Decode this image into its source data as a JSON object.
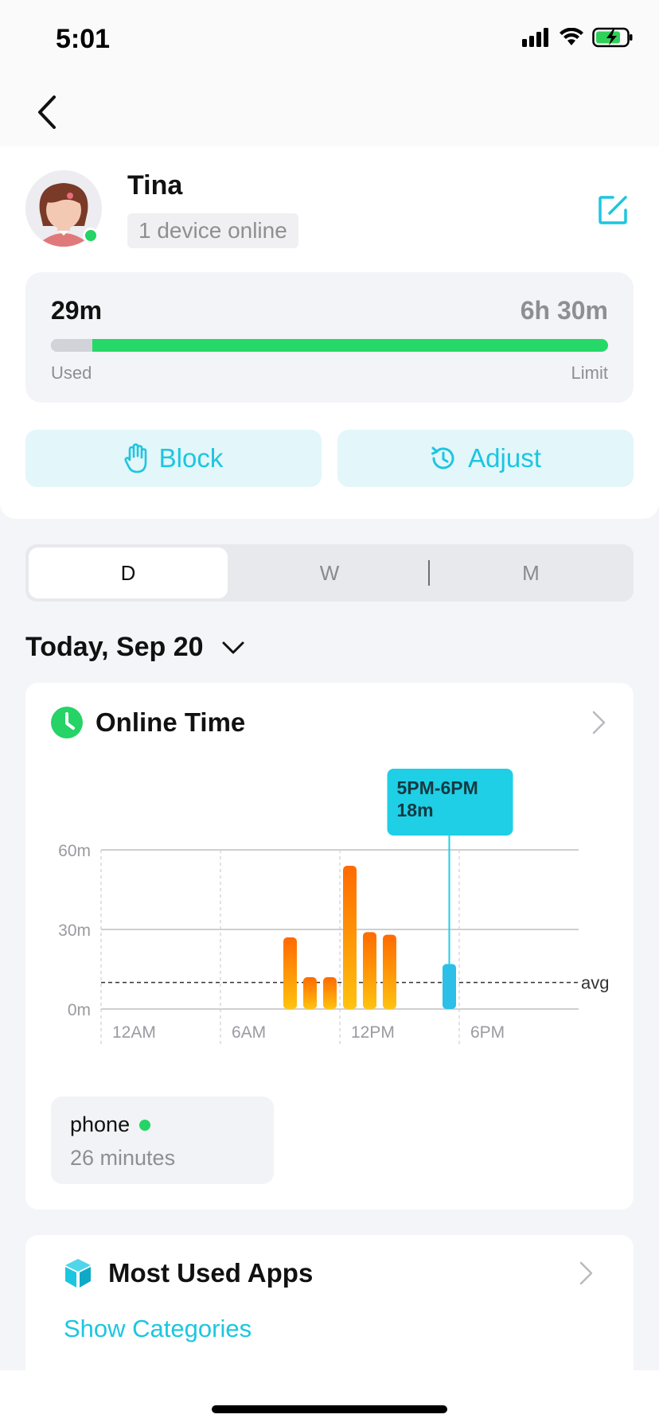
{
  "status_bar": {
    "time": "5:01"
  },
  "profile": {
    "name": "Tina",
    "device_status": "1 device online",
    "avatar_icon": "girl-avatar-icon",
    "edit_icon": "edit-icon"
  },
  "usage": {
    "used_value": "29m",
    "limit_value": "6h 30m",
    "used_label": "Used",
    "limit_label": "Limit",
    "used_fraction": 0.074,
    "track_color": "#26d868"
  },
  "actions": {
    "block_label": "Block",
    "adjust_label": "Adjust",
    "accent_color": "#1cc6e0"
  },
  "period_tabs": {
    "items": [
      "D",
      "W",
      "M"
    ],
    "selected": "D"
  },
  "date_selector": {
    "label": "Today, Sep 20"
  },
  "online_time": {
    "title": "Online Time",
    "device": {
      "name": "phone",
      "minutes": "26 minutes"
    }
  },
  "most_used_apps": {
    "title": "Most Used Apps",
    "link": "Show Categories"
  },
  "chart_data": {
    "type": "bar",
    "title": "Online Time",
    "x_tick_labels": [
      "12AM",
      "6AM",
      "12PM",
      "6PM"
    ],
    "y_tick_labels": [
      "60m",
      "30m",
      "0m"
    ],
    "ylim": [
      0,
      60
    ],
    "categories": [
      "9AM",
      "10AM",
      "11AM",
      "12PM",
      "1PM",
      "2PM",
      "3PM",
      "4PM",
      "5PM"
    ],
    "hours": [
      9,
      10,
      11,
      12,
      13,
      14,
      15,
      16,
      17
    ],
    "values": [
      27,
      12,
      12,
      54,
      29,
      28,
      0,
      0,
      17
    ],
    "average": 10,
    "average_label": "avg",
    "selected_index": 8,
    "tooltip": {
      "range": "5PM-6PM",
      "value": "18m"
    },
    "colors": {
      "bar_top": "#ff6a00",
      "bar_bottom": "#ffc20f",
      "selected": "#2cc0e8",
      "tooltip": "#1ecfe6"
    }
  }
}
